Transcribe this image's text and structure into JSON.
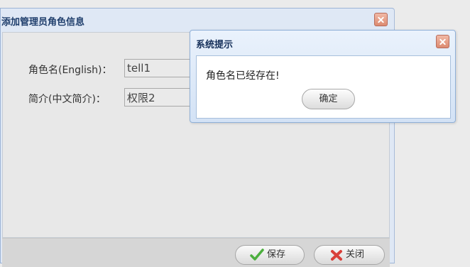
{
  "window": {
    "title": "添加管理员角色信息",
    "form": [
      {
        "label": "角色名(English)：",
        "value": "tell1"
      },
      {
        "label": "简介(中文简介)：",
        "value": "权限2"
      }
    ],
    "save_label": "保存",
    "close_label": "关闭"
  },
  "dialog": {
    "title": "系统提示",
    "message": "角色名已经存在!",
    "ok_label": "确定"
  },
  "colors": {
    "title_text": "#1f3e6c",
    "close_button": "#dc8a70",
    "save_icon": "#4caf3e",
    "close_icon": "#d9403a"
  },
  "icons": [
    "close-icon",
    "checkmark-icon",
    "cross-icon"
  ]
}
